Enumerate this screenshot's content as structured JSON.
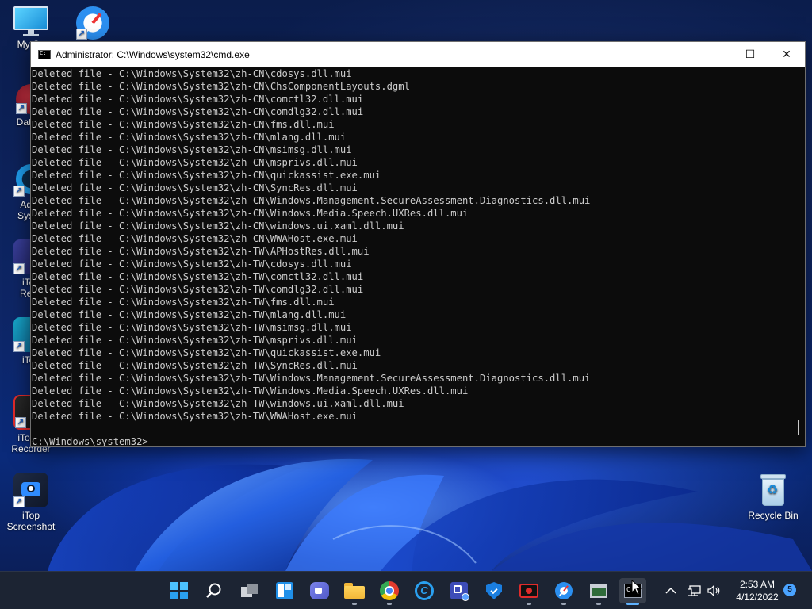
{
  "desktop": {
    "icons": [
      {
        "label": "My Co"
      },
      {
        "label": ""
      },
      {
        "label": "DataW"
      },
      {
        "label": "Adva",
        "label2": "Syster"
      },
      {
        "label": "iTop",
        "label2": "Reco"
      },
      {
        "label": "iTop"
      },
      {
        "label": "iTop S",
        "label2": "Recorder"
      },
      {
        "label": "iTop",
        "label2": "Screenshot"
      },
      {
        "label": "Recycle Bin"
      }
    ]
  },
  "cmd": {
    "title": "Administrator: C:\\Windows\\system32\\cmd.exe",
    "minimize": "—",
    "maximize": "☐",
    "close": "✕",
    "lines": [
      "Deleted file - C:\\Windows\\System32\\zh-CN\\cdosys.dll.mui",
      "Deleted file - C:\\Windows\\System32\\zh-CN\\ChsComponentLayouts.dgml",
      "Deleted file - C:\\Windows\\System32\\zh-CN\\comctl32.dll.mui",
      "Deleted file - C:\\Windows\\System32\\zh-CN\\comdlg32.dll.mui",
      "Deleted file - C:\\Windows\\System32\\zh-CN\\fms.dll.mui",
      "Deleted file - C:\\Windows\\System32\\zh-CN\\mlang.dll.mui",
      "Deleted file - C:\\Windows\\System32\\zh-CN\\msimsg.dll.mui",
      "Deleted file - C:\\Windows\\System32\\zh-CN\\msprivs.dll.mui",
      "Deleted file - C:\\Windows\\System32\\zh-CN\\quickassist.exe.mui",
      "Deleted file - C:\\Windows\\System32\\zh-CN\\SyncRes.dll.mui",
      "Deleted file - C:\\Windows\\System32\\zh-CN\\Windows.Management.SecureAssessment.Diagnostics.dll.mui",
      "Deleted file - C:\\Windows\\System32\\zh-CN\\Windows.Media.Speech.UXRes.dll.mui",
      "Deleted file - C:\\Windows\\System32\\zh-CN\\windows.ui.xaml.dll.mui",
      "Deleted file - C:\\Windows\\System32\\zh-CN\\WWAHost.exe.mui",
      "Deleted file - C:\\Windows\\System32\\zh-TW\\APHostRes.dll.mui",
      "Deleted file - C:\\Windows\\System32\\zh-TW\\cdosys.dll.mui",
      "Deleted file - C:\\Windows\\System32\\zh-TW\\comctl32.dll.mui",
      "Deleted file - C:\\Windows\\System32\\zh-TW\\comdlg32.dll.mui",
      "Deleted file - C:\\Windows\\System32\\zh-TW\\fms.dll.mui",
      "Deleted file - C:\\Windows\\System32\\zh-TW\\mlang.dll.mui",
      "Deleted file - C:\\Windows\\System32\\zh-TW\\msimsg.dll.mui",
      "Deleted file - C:\\Windows\\System32\\zh-TW\\msprivs.dll.mui",
      "Deleted file - C:\\Windows\\System32\\zh-TW\\quickassist.exe.mui",
      "Deleted file - C:\\Windows\\System32\\zh-TW\\SyncRes.dll.mui",
      "Deleted file - C:\\Windows\\System32\\zh-TW\\Windows.Management.SecureAssessment.Diagnostics.dll.mui",
      "Deleted file - C:\\Windows\\System32\\zh-TW\\Windows.Media.Speech.UXRes.dll.mui",
      "Deleted file - C:\\Windows\\System32\\zh-TW\\windows.ui.xaml.dll.mui",
      "Deleted file - C:\\Windows\\System32\\zh-TW\\WWAHost.exe.mui",
      "",
      "C:\\Windows\\system32>"
    ]
  },
  "taskbar": {
    "apps": [
      {
        "name": "start-icon",
        "active": false
      },
      {
        "name": "search-icon",
        "active": false
      },
      {
        "name": "task-view-icon",
        "active": false
      },
      {
        "name": "widgets-icon",
        "active": false
      },
      {
        "name": "chat-icon",
        "active": false
      },
      {
        "name": "file-explorer-icon",
        "active": false
      },
      {
        "name": "chrome-icon",
        "active": false
      },
      {
        "name": "ccleaner-icon",
        "active": false
      },
      {
        "name": "remote-app-icon",
        "active": false
      },
      {
        "name": "shield-app-icon",
        "active": false
      },
      {
        "name": "screen-recorder-icon",
        "active": false
      },
      {
        "name": "safari-icon",
        "active": false
      },
      {
        "name": "window-app-icon",
        "active": false
      },
      {
        "name": "terminal-icon",
        "active": true
      }
    ],
    "clock": {
      "time": "2:53 AM",
      "date": "4/12/2022"
    },
    "notification_count": "5"
  },
  "colors": {
    "console_bg": "#0c0c0c",
    "console_fg": "#cccccc",
    "taskbar_bg": "#1c2433",
    "accent": "#5fb2ff"
  }
}
